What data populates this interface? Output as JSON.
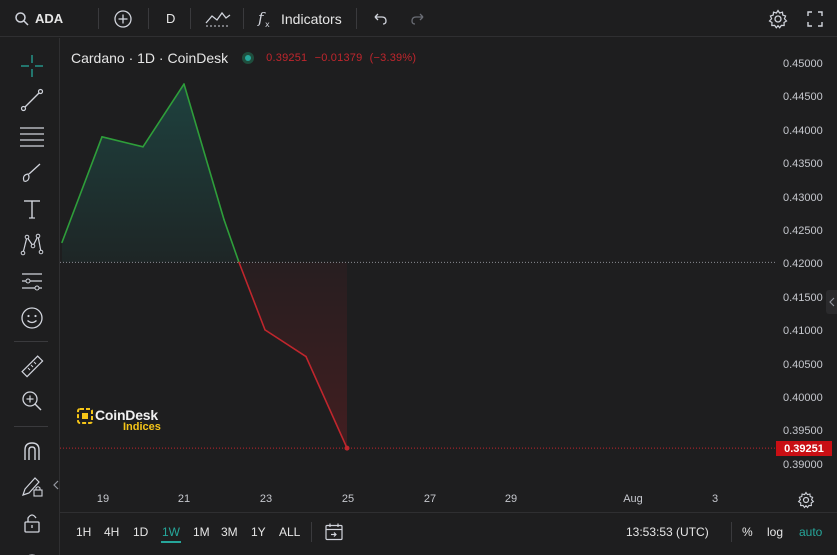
{
  "toolbar": {
    "symbol": "ADA",
    "interval": "D",
    "indicators_label": "Indicators"
  },
  "legend": {
    "title": "Cardano · 1D · CoinDesk",
    "last": "0.39251",
    "change": "−0.01379",
    "change_pct": "(−3.39%)"
  },
  "watermark": {
    "line1": "CoinDesk",
    "line2": "Indices"
  },
  "price_axis": {
    "ticks": [
      "0.45000",
      "0.44500",
      "0.44000",
      "0.43500",
      "0.43000",
      "0.42500",
      "0.42000",
      "0.41500",
      "0.41000",
      "0.40500",
      "0.40000",
      "0.39500",
      "0.39000"
    ],
    "last_price_badge": "0.39251"
  },
  "time_axis": {
    "ticks": [
      "19",
      "21",
      "23",
      "25",
      "27",
      "29",
      "Aug",
      "3"
    ]
  },
  "bottom": {
    "ranges": [
      "1H",
      "4H",
      "1D",
      "1W",
      "1M",
      "3M",
      "1Y",
      "ALL"
    ],
    "active_range": "1W",
    "clock": "13:53:53 (UTC)",
    "percent_label": "%",
    "log_label": "log",
    "auto_label": "auto"
  },
  "colors": {
    "up": "#26a69a",
    "line_up": "#2e9e3a",
    "line_down": "#c0262d",
    "badge": "#c90f14",
    "background": "#1e1e1f"
  },
  "chart_data": {
    "type": "line",
    "x": [
      "Jul 18",
      "Jul 19",
      "Jul 20",
      "Jul 21",
      "Jul 22",
      "Jul 22",
      "Jul 23",
      "Jul 24",
      "Jul 25"
    ],
    "values": [
      0.4233,
      0.4391,
      0.4376,
      0.447,
      0.4267,
      0.4203,
      0.4102,
      0.4062,
      0.3925
    ],
    "baseline": 0.4203,
    "ylim": [
      0.3885,
      0.4515
    ],
    "series": [
      {
        "name": "Cardano · 1D · CoinDesk",
        "values": [
          0.4233,
          0.4391,
          0.4376,
          0.447,
          0.4267,
          0.4203,
          0.4102,
          0.4062,
          0.3925
        ]
      }
    ],
    "title": "Cardano · 1D · CoinDesk",
    "xlabel": "",
    "ylabel": "",
    "grid": false
  }
}
